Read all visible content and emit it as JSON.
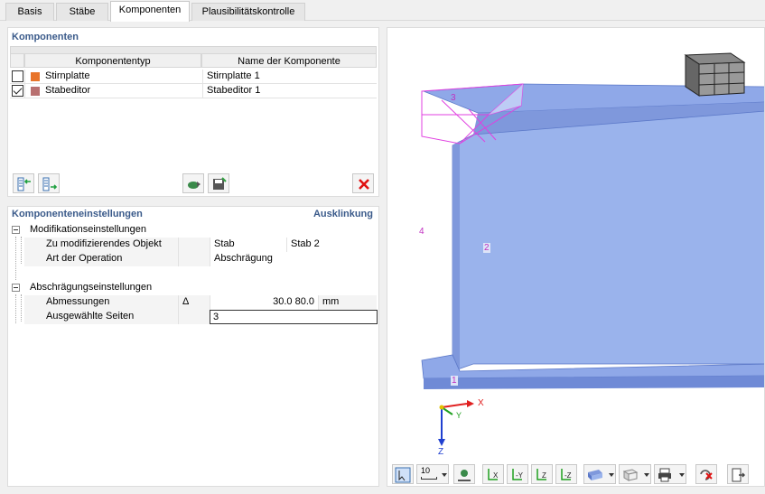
{
  "tabs": [
    {
      "label": "Basis"
    },
    {
      "label": "Stäbe"
    },
    {
      "label": "Komponenten",
      "active": true
    },
    {
      "label": "Plausibilitätskontrolle"
    }
  ],
  "components": {
    "title": "Komponenten",
    "columns": [
      "Komponententyp",
      "Name der Komponente"
    ],
    "rows": [
      {
        "checked": false,
        "color": "#e8742a",
        "type": "Stirnplatte",
        "name": "Stirnplatte 1"
      },
      {
        "checked": true,
        "color": "#b87070",
        "type": "Stabeditor",
        "name": "Stabeditor 1"
      }
    ]
  },
  "settings": {
    "title": "Komponenteneinstellungen",
    "right_title": "Ausklinkung",
    "groups": [
      {
        "label": "Modifikationseinstellungen",
        "items": [
          {
            "label": "Zu modifizierendes Objekt",
            "symbol": "",
            "value": "Stab",
            "value2": "Stab 2"
          },
          {
            "label": "Art der Operation",
            "symbol": "",
            "value": "Abschrägung",
            "value2": ""
          }
        ]
      },
      {
        "label": "Abschrägungseinstellungen",
        "items": [
          {
            "label": "Abmessungen",
            "symbol": "Δ",
            "value": "30.0 80.0",
            "unit": "mm"
          },
          {
            "label": "Ausgewählte Seiten",
            "symbol": "",
            "value": "3",
            "unit": ""
          }
        ]
      }
    ]
  },
  "viewport": {
    "labels": {
      "l3": "3",
      "l4": "4",
      "l2": "2",
      "l1": "1"
    },
    "axes": {
      "x": "X",
      "y": "Y",
      "z": "Z"
    },
    "colors": {
      "beam": "#8fa8e8",
      "beam_dark": "#6f8ad6",
      "highlight": "#e040e0",
      "axis_x": "#e02020",
      "axis_y": "#20a020",
      "axis_z": "#2040d0"
    },
    "toolbar": {
      "zoom_value": "10"
    }
  }
}
